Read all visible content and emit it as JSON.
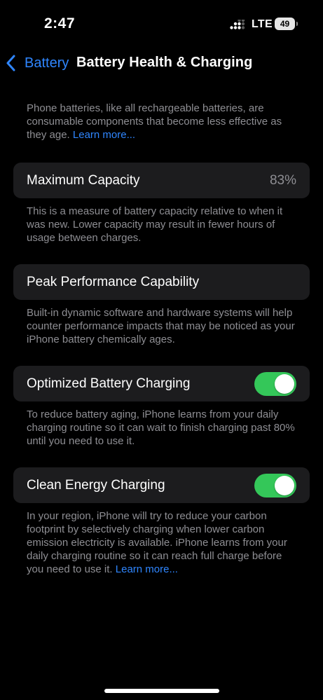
{
  "status_bar": {
    "time": "2:47",
    "network": "LTE",
    "battery_level": "49",
    "signal_icon": "signal-bars-icon",
    "battery_icon": "battery-icon"
  },
  "nav": {
    "back_label": "Battery",
    "back_icon": "chevron-left-icon",
    "title": "Battery Health & Charging"
  },
  "intro": {
    "text": "Phone batteries, like all rechargeable batteries, are consumable components that become less effective as they age. ",
    "link": "Learn more..."
  },
  "maximum_capacity": {
    "label": "Maximum Capacity",
    "value": "83%",
    "description": "This is a measure of battery capacity relative to when it was new. Lower capacity may result in fewer hours of usage between charges."
  },
  "peak_performance": {
    "label": "Peak Performance Capability",
    "description": "Built-in dynamic software and hardware systems will help counter performance impacts that may be noticed as your iPhone battery chemically ages."
  },
  "optimized_charging": {
    "label": "Optimized Battery Charging",
    "enabled": true,
    "description": "To reduce battery aging, iPhone learns from your daily charging routine so it can wait to finish charging past 80% until you need to use it."
  },
  "clean_energy": {
    "label": "Clean Energy Charging",
    "enabled": true,
    "description": "In your region, iPhone will try to reduce your carbon footprint by selectively charging when lower carbon emission electricity is available. iPhone learns from your daily charging routine so it can reach full charge before you need to use it. ",
    "link": "Learn more..."
  },
  "colors": {
    "background": "#000000",
    "cell": "#1c1c1e",
    "secondary_text": "#8e8e93",
    "accent": "#2f86ff",
    "toggle_on": "#34c759"
  }
}
